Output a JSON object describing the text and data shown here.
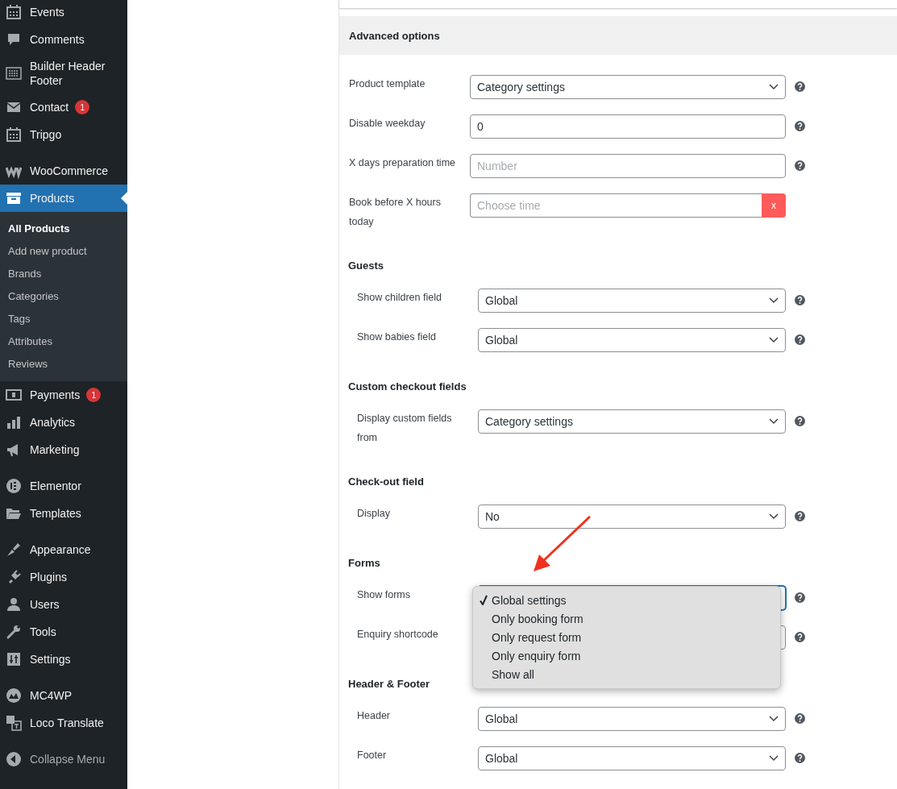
{
  "sidebar": {
    "groups": [
      [
        {
          "label": "Events",
          "selected": false
        },
        {
          "label": "Comments",
          "selected": false
        },
        {
          "label": "Builder Header Footer",
          "selected": false
        },
        {
          "label": "Contact",
          "selected": false,
          "badge": "1"
        },
        {
          "label": "Tripgo",
          "selected": false
        }
      ],
      [
        {
          "label": "WooCommerce",
          "selected": false
        },
        {
          "label": "Products",
          "selected": true,
          "children": [
            {
              "label": "All Products",
              "selected": true
            },
            {
              "label": "Add new product",
              "selected": false
            },
            {
              "label": "Brands",
              "selected": false
            },
            {
              "label": "Categories",
              "selected": false
            },
            {
              "label": "Tags",
              "selected": false
            },
            {
              "label": "Attributes",
              "selected": false
            },
            {
              "label": "Reviews",
              "selected": false
            }
          ]
        },
        {
          "label": "Payments",
          "selected": false,
          "badge": "1"
        },
        {
          "label": "Analytics",
          "selected": false
        },
        {
          "label": "Marketing",
          "selected": false
        }
      ],
      [
        {
          "label": "Elementor",
          "selected": false
        },
        {
          "label": "Templates",
          "selected": false
        }
      ],
      [
        {
          "label": "Appearance",
          "selected": false
        },
        {
          "label": "Plugins",
          "selected": false
        },
        {
          "label": "Users",
          "selected": false
        },
        {
          "label": "Tools",
          "selected": false
        },
        {
          "label": "Settings",
          "selected": false
        }
      ],
      [
        {
          "label": "MC4WP",
          "selected": false
        },
        {
          "label": "Loco Translate",
          "selected": false
        }
      ]
    ],
    "collapse_label": "Collapse Menu"
  },
  "panel": {
    "title": "Advanced options",
    "sections": [
      {
        "rows": [
          {
            "label": "Product template",
            "kind": "select",
            "value": "Category settings",
            "help": true
          },
          {
            "label": "Disable weekday",
            "kind": "text",
            "value": "0",
            "help": true
          },
          {
            "label": "X days preparation time",
            "kind": "text",
            "placeholder": "Number",
            "help": true
          },
          {
            "label": "Book before X hours today",
            "kind": "time",
            "placeholder": "Choose time",
            "clear_label": "x",
            "help": false
          }
        ]
      },
      {
        "heading": "Guests",
        "rows": [
          {
            "label": "Show children field",
            "kind": "select",
            "value": "Global",
            "help": true
          },
          {
            "label": "Show babies field",
            "kind": "select",
            "value": "Global",
            "help": true
          }
        ]
      },
      {
        "heading": "Custom checkout fields",
        "rows": [
          {
            "label": "Display custom fields from",
            "kind": "select",
            "value": "Category settings",
            "help": true
          }
        ]
      },
      {
        "heading": "Check-out field",
        "rows": [
          {
            "label": "Display",
            "kind": "select",
            "value": "No",
            "help": true
          }
        ]
      },
      {
        "heading": "Forms",
        "rows": [
          {
            "label": "Show forms",
            "kind": "select",
            "open": true,
            "help": true,
            "options": [
              {
                "label": "Global settings",
                "selected": true
              },
              {
                "label": "Only booking form",
                "selected": false
              },
              {
                "label": "Only request form",
                "selected": false
              },
              {
                "label": "Only enquiry form",
                "selected": false
              },
              {
                "label": "Show all",
                "selected": false
              }
            ]
          },
          {
            "label": "Enquiry shortcode",
            "kind": "text",
            "help": true
          }
        ]
      },
      {
        "heading": "Header & Footer",
        "rows": [
          {
            "label": "Header",
            "kind": "select",
            "value": "Global",
            "help": true
          },
          {
            "label": "Footer",
            "kind": "select",
            "value": "Global",
            "help": true
          }
        ]
      }
    ]
  }
}
